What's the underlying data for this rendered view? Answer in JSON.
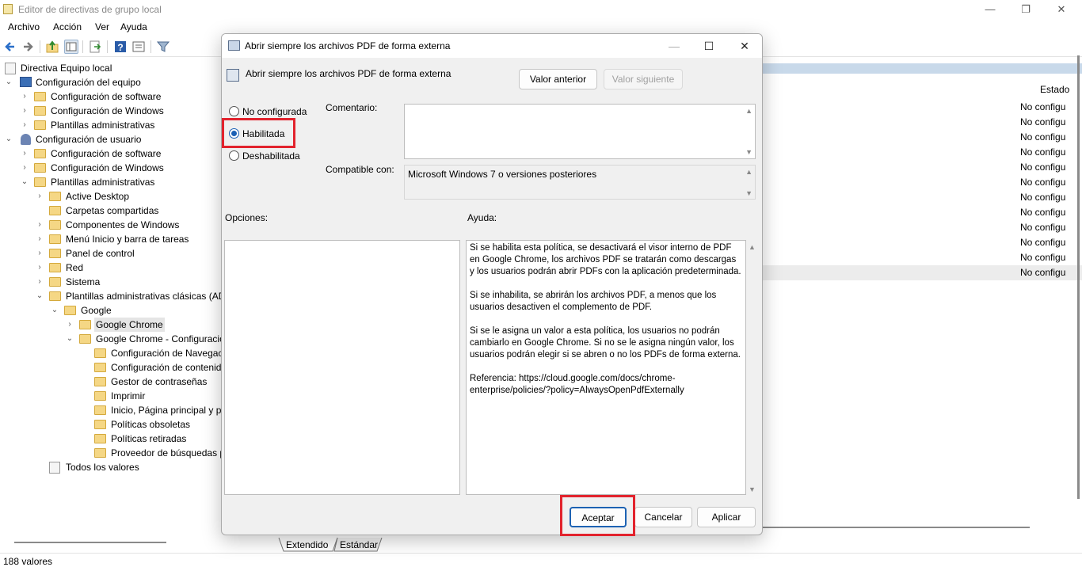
{
  "app": {
    "title": "Editor de directivas de grupo local",
    "window_controls": {
      "minimize": "—",
      "maximize": "❐",
      "close": "✕"
    }
  },
  "menu": [
    "Archivo",
    "Acción",
    "Ver",
    "Ayuda"
  ],
  "toolbar_icons": [
    "back-icon",
    "forward-icon",
    "up-folder-icon",
    "show-hide-tree-icon",
    "export-list-icon",
    "help-icon",
    "properties-icon",
    "filter-icon"
  ],
  "tree": {
    "root": "Directiva Equipo local",
    "items": [
      {
        "label": "Configuración del equipo"
      },
      {
        "label": "Configuración de software"
      },
      {
        "label": "Configuración de Windows"
      },
      {
        "label": "Plantillas administrativas"
      },
      {
        "label": "Configuración de usuario"
      },
      {
        "label": "Configuración de software"
      },
      {
        "label": "Configuración de Windows"
      },
      {
        "label": "Plantillas administrativas"
      },
      {
        "label": "Active Desktop"
      },
      {
        "label": "Carpetas compartidas"
      },
      {
        "label": "Componentes de Windows"
      },
      {
        "label": "Menú Inicio y barra de tareas"
      },
      {
        "label": "Panel de control"
      },
      {
        "label": "Red"
      },
      {
        "label": "Sistema"
      },
      {
        "label": "Plantillas administrativas clásicas (ADM)"
      },
      {
        "label": "Google"
      },
      {
        "label": "Google Chrome"
      },
      {
        "label": "Google Chrome - Configuración predeterminada"
      },
      {
        "label": "Configuración de Navegación segura"
      },
      {
        "label": "Configuración de contenido"
      },
      {
        "label": "Gestor de contraseñas"
      },
      {
        "label": "Imprimir"
      },
      {
        "label": "Inicio, Página principal y página Nueva pestaña"
      },
      {
        "label": "Políticas obsoletas"
      },
      {
        "label": "Políticas retiradas"
      },
      {
        "label": "Proveedor de búsquedas predeterminado"
      },
      {
        "label": "Todos los valores"
      }
    ]
  },
  "right_pane": {
    "column_header": "Estado",
    "rows": [
      "No configu",
      "No configu",
      "No configu",
      "No configu",
      "No configu",
      "No configu",
      "No configu",
      "No configu",
      "No configu",
      "No configu",
      "No configu",
      "No configu"
    ]
  },
  "bottom_tabs": [
    "Extendido",
    "Estándar"
  ],
  "status": "188 valores",
  "dialog": {
    "title": "Abrir siempre los archivos PDF de forma externa",
    "policy_name": "Abrir siempre los archivos PDF de forma externa",
    "prev_button": "Valor anterior",
    "next_button": "Valor siguiente",
    "options": {
      "not_configured": "No configurada",
      "enabled": "Habilitada",
      "disabled": "Deshabilitada",
      "selected": "enabled"
    },
    "comment_label": "Comentario:",
    "comment_value": "",
    "compatible_label": "Compatible con:",
    "compatible_value": "Microsoft Windows 7 o versiones posteriores",
    "opciones_label": "Opciones:",
    "ayuda_label": "Ayuda:",
    "help_text": "Si se habilita esta política, se desactivará el visor interno de PDF en Google Chrome, los archivos PDF se tratarán como descargas y los usuarios podrán abrir PDFs con la aplicación predeterminada.\n\nSi se inhabilita, se abrirán los archivos PDF, a menos que los usuarios desactiven el complemento de PDF.\n\nSi se le asigna un valor a esta política, los usuarios no podrán cambiarlo en Google Chrome. Si no se le asigna ningún valor, los usuarios podrán elegir si se abren o no los PDFs de forma externa.\n\nReferencia: https://cloud.google.com/docs/chrome-enterprise/policies/?policy=AlwaysOpenPdfExternally",
    "ok_button": "Aceptar",
    "cancel_button": "Cancelar",
    "apply_button": "Aplicar"
  },
  "colors": {
    "highlight_red": "#e2232d",
    "accent_blue": "#1a5fb4",
    "selection_gray": "#e5e5e5"
  }
}
